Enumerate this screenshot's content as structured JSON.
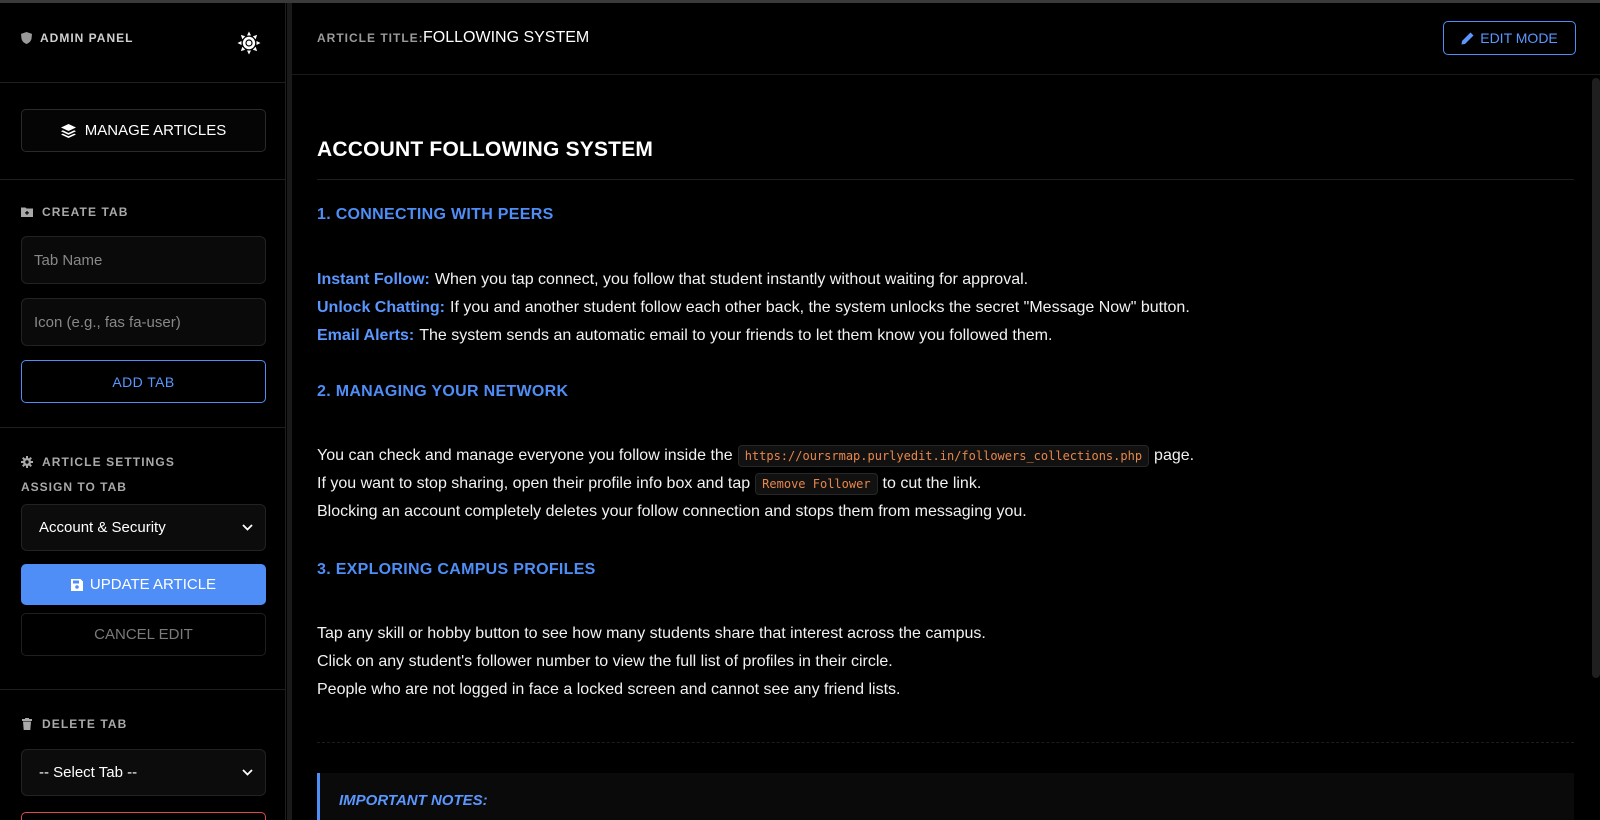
{
  "sidebar": {
    "brand": "ADMIN PANEL",
    "manage_label": "MANAGE ARTICLES",
    "create_tab": {
      "heading": "CREATE TAB",
      "name_placeholder": "Tab Name",
      "icon_placeholder": "Icon (e.g., fas fa-user)",
      "add_label": "ADD TAB"
    },
    "article_settings": {
      "heading": "ARTICLE SETTINGS",
      "assign_label": "ASSIGN TO TAB",
      "selected_tab": "Account & Security",
      "update_label": "UPDATE ARTICLE",
      "cancel_label": "CANCEL EDIT"
    },
    "delete_tab": {
      "heading": "DELETE TAB",
      "selected": "-- Select Tab --"
    }
  },
  "header": {
    "title_label": "ARTICLE TITLE:",
    "title_value": "FOLLOWING SYSTEM",
    "edit_label": "EDIT MODE"
  },
  "article": {
    "title": "ACCOUNT FOLLOWING SYSTEM",
    "s1": {
      "heading": "1. CONNECTING WITH PEERS",
      "l1_kw": "Instant Follow:",
      "l1_text": "When you tap connect, you follow that student instantly without waiting for approval.",
      "l2_kw": "Unlock Chatting:",
      "l2_text": "If you and another student follow each other back, the system unlocks the secret \"Message Now\" button.",
      "l3_kw": "Email Alerts:",
      "l3_text": "The system sends an automatic email to your friends to let them know you followed them."
    },
    "s2": {
      "heading": "2. MANAGING YOUR NETWORK",
      "l1_pre": "You can check and manage everyone you follow inside the",
      "l1_code": "https://oursrmap.purlyedit.in/followers_collections.php",
      "l1_post": "page.",
      "l2_pre": "If you want to stop sharing, open their profile info box and tap",
      "l2_code": "Remove Follower",
      "l2_post": "to cut the link.",
      "l3": "Blocking an account completely deletes your follow connection and stops them from messaging you."
    },
    "s3": {
      "heading": "3. EXPLORING CAMPUS PROFILES",
      "l1": "Tap any skill or hobby button to see how many students share that interest across the campus.",
      "l2": "Click on any student's follower number to view the full list of profiles in their circle.",
      "l3": "People who are not logged in face a locked screen and cannot see any friend lists."
    },
    "notes_heading": "IMPORTANT NOTES:"
  },
  "colors": {
    "accent": "#4f8ef7",
    "danger": "#e04848",
    "code": "#e8874a"
  }
}
